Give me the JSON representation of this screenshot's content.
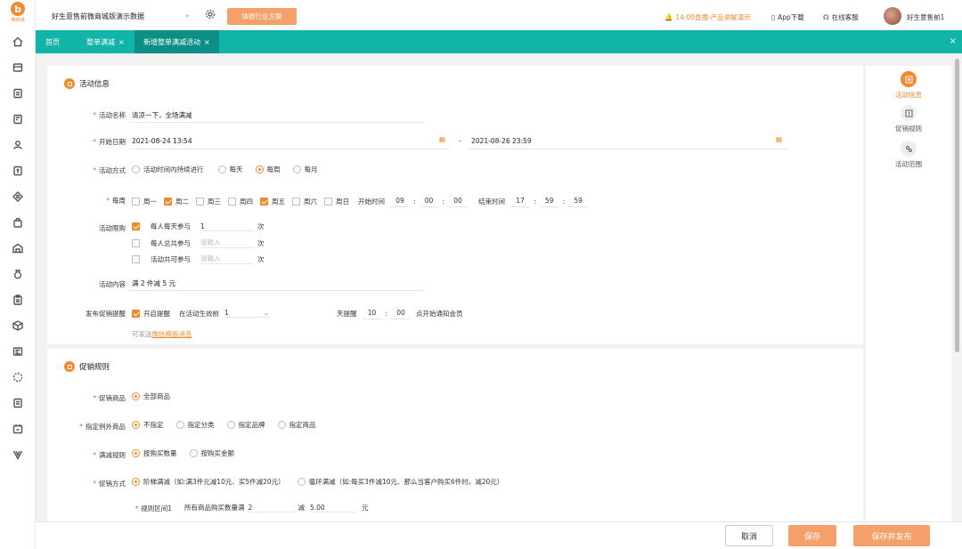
{
  "logo": {
    "mark": "b",
    "text": "微商城"
  },
  "topbar": {
    "store_name": "好生意售前微商城版演示数据",
    "trial_button": "体验行业方案",
    "live_text": "14:00直播-产品讲解演示",
    "app_download": "App下载",
    "online_service": "在线客服",
    "username": "好生意售前1"
  },
  "tabs": [
    {
      "label": "首页"
    },
    {
      "label": "整单满减",
      "close": "×"
    },
    {
      "label": "新增整单满减活动",
      "close": "×"
    }
  ],
  "tabbar_close": "×",
  "activity_info": {
    "title": "活动信息",
    "name_label": "活动名称",
    "name_value": "清凉一下，全场满减",
    "date_label": "开始日期",
    "start_date": "2021-08-24 13:54",
    "date_sep": "-",
    "end_date": "2021-08-26 23:59",
    "mode_label": "活动方式",
    "mode_options": [
      "活动时间内持续进行",
      "每天",
      "每周",
      "每月"
    ],
    "mode_selected": 2,
    "weekly_label": "每周",
    "weekdays": [
      "周一",
      "周二",
      "周三",
      "周四",
      "周五",
      "周六",
      "周日"
    ],
    "weekdays_checked": [
      false,
      true,
      false,
      false,
      true,
      false,
      false
    ],
    "start_time_label": "开始时间",
    "start_time": [
      "09",
      "00",
      "00"
    ],
    "end_time_label": "结束时间",
    "end_time": [
      "17",
      "59",
      "59"
    ],
    "limit_label": "活动限购",
    "limits": [
      {
        "label": "每人每天参与",
        "value": "1",
        "placeholder": "",
        "unit": "次",
        "checked": true
      },
      {
        "label": "每人总共参与",
        "value": "",
        "placeholder": "请输入",
        "unit": "次",
        "checked": false
      },
      {
        "label": "活动共可参与",
        "value": "",
        "placeholder": "请输入",
        "unit": "次",
        "checked": false
      }
    ],
    "content_label": "活动内容",
    "content_value": "满 2 件减 5 元",
    "notify_label": "发布促销提醒",
    "notify_check": "开启提醒",
    "notify_before": "在活动生效前",
    "notify_days": "1",
    "notify_days_unit": "天提醒",
    "notify_hour": "10",
    "notify_min": "00",
    "notify_tail": "点开始通知会员",
    "send_prefix": "可发送",
    "send_link": "微信模版消息"
  },
  "promo_rules": {
    "title": "促销规则",
    "goods_label": "促销商品",
    "goods_option": "全部商品",
    "exclude_label": "指定例外商品",
    "exclude_options": [
      "不指定",
      "指定分类",
      "指定品牌",
      "指定商品"
    ],
    "exclude_selected": 0,
    "rule_label": "满减规则",
    "rule_options": [
      "按购买数量",
      "按购买金额"
    ],
    "rule_selected": 0,
    "method_label": "促销方式",
    "method_options": [
      "阶梯满减（如:满3件元减10元、买5件减20元）",
      "循环满减（如:每买3件减10元、那么当客户购买6件时，减20元）"
    ],
    "method_selected": 0,
    "range_label": "规则区间1",
    "range_text": "所有商品购买数量满",
    "range_qty": "2",
    "range_minus": "减",
    "range_amount": "5.00",
    "range_unit": "元"
  },
  "right_nav": [
    {
      "label": "活动信息",
      "active": true
    },
    {
      "label": "促销规则",
      "active": false
    },
    {
      "label": "活动范围",
      "active": false
    }
  ],
  "footer": {
    "cancel": "取消",
    "save": "保存",
    "save_publish": "保存并发布"
  },
  "colors": {
    "accent": "#f08a2e",
    "teal": "#12b3a8",
    "button": "#f5a06b"
  }
}
